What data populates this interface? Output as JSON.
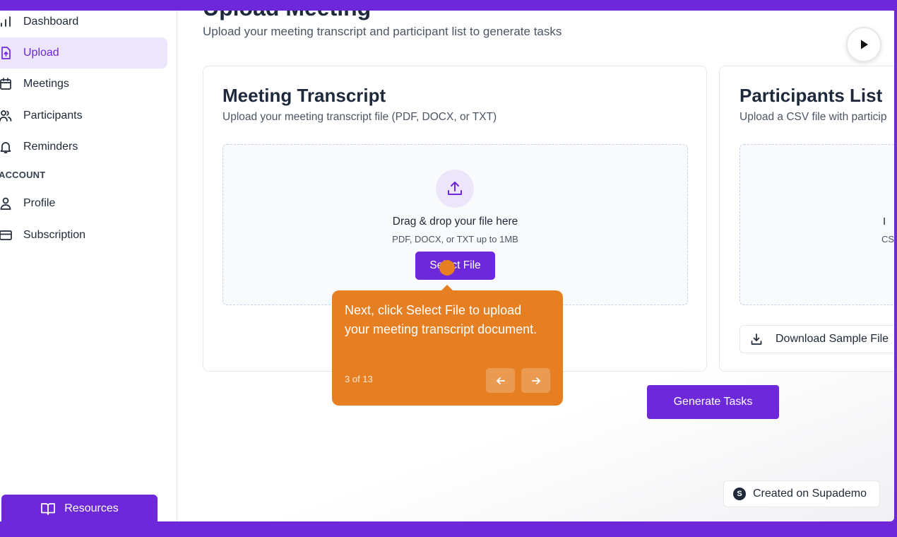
{
  "sidebar": {
    "items": [
      {
        "label": "Dashboard",
        "icon": "bar-chart-icon"
      },
      {
        "label": "Upload",
        "icon": "file-upload-icon"
      },
      {
        "label": "Meetings",
        "icon": "calendar-icon"
      },
      {
        "label": "Participants",
        "icon": "users-icon"
      },
      {
        "label": "Reminders",
        "icon": "bell-icon"
      }
    ],
    "account_label": "ACCOUNT",
    "account_items": [
      {
        "label": "Profile",
        "icon": "user-icon"
      },
      {
        "label": "Subscription",
        "icon": "credit-card-icon"
      }
    ],
    "resources_label": "Resources"
  },
  "header": {
    "title": "Upload Meeting",
    "subtitle": "Upload your meeting transcript and participant list to generate tasks"
  },
  "transcript_card": {
    "title": "Meeting Transcript",
    "description": "Upload your meeting transcript file (PDF, DOCX, or TXT)",
    "dropzone_title": "Drag & drop your file here",
    "dropzone_hint": "PDF, DOCX, or TXT up to 1MB",
    "select_label": "Select File"
  },
  "participants_card": {
    "title": "Participants List",
    "description": "Upload a CSV file with particip",
    "dropzone_line1": "I",
    "dropzone_line2": "CS",
    "download_label": "Download Sample File"
  },
  "generate_label": "Generate Tasks",
  "tooltip": {
    "text": "Next, click Select File to upload your meeting transcript document.",
    "step": "3 of 13"
  },
  "badge_label": "Created on Supademo",
  "colors": {
    "brand": "#6d28d9",
    "tooltip": "#e67e22",
    "active_bg": "#ede6fb"
  }
}
